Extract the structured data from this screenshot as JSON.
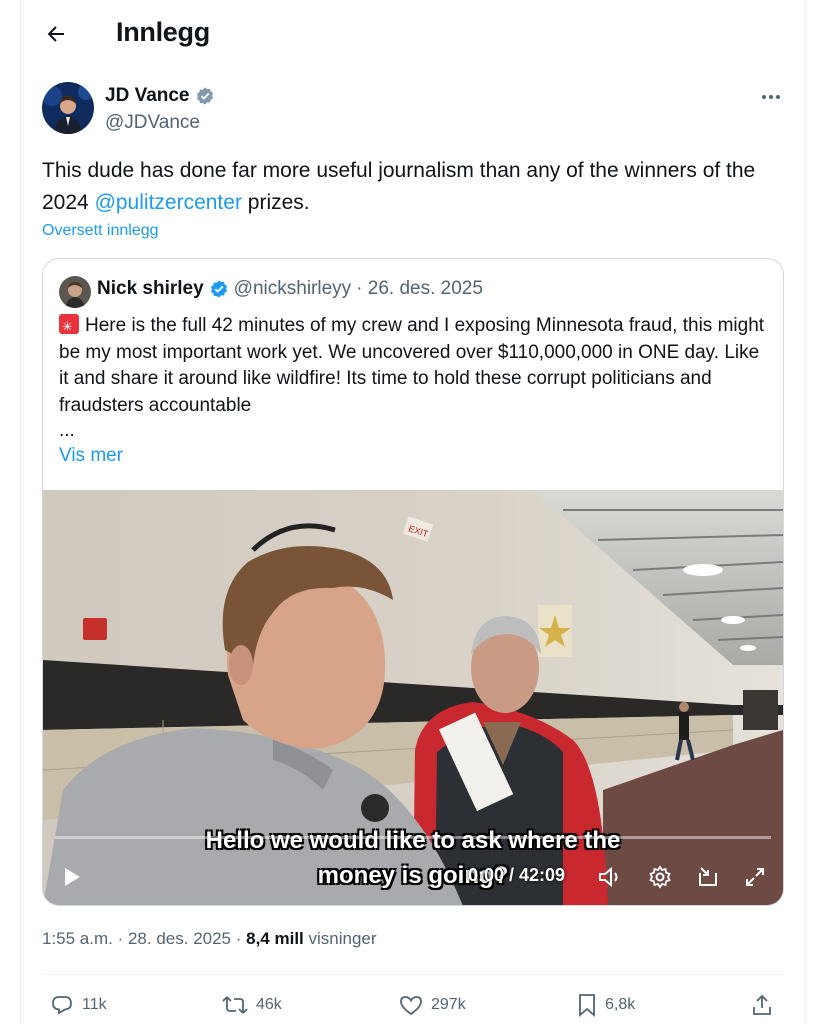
{
  "header": {
    "title": "Innlegg"
  },
  "post": {
    "author": {
      "name": "JD Vance",
      "handle": "@JDVance",
      "verified_icon": "verified-badge-icon"
    },
    "text_parts": {
      "before": "This dude has done far more useful journalism than any of the winners of the 2024 ",
      "mention": "@pulitzercenter",
      "after": " prizes."
    },
    "translate_label": "Oversett innlegg",
    "timestamp": "1:55 a.m. · 28. des. 2025 · ",
    "views_count": "8,4 mill",
    "views_label": " visninger"
  },
  "quote": {
    "author": {
      "name": "Nick shirley",
      "handle": "@nickshirleyy",
      "date": "· 26. des. 2025"
    },
    "text": "Here is the full 42 minutes of my crew and I exposing Minnesota fraud, this might be my most important work yet. We uncovered over $110,000,000 in ONE day. Like it and share it around like wildfire! Its time to hold these corrupt politicians and fraudsters accountable",
    "ellipsis": "...",
    "show_more_label": "Vis mer",
    "video": {
      "subtitle_line1": "Hello we would like to ask where the",
      "subtitle_line2": "money is going?",
      "time": "0:00 / 42:09",
      "progress": 0.0
    }
  },
  "actions": {
    "replies": "11k",
    "reposts": "46k",
    "likes": "297k",
    "bookmarks": "6,8k"
  },
  "colors": {
    "accent": "#1d9bf0",
    "text": "#0f1419",
    "muted": "#536471",
    "border": "#cfd9de"
  }
}
